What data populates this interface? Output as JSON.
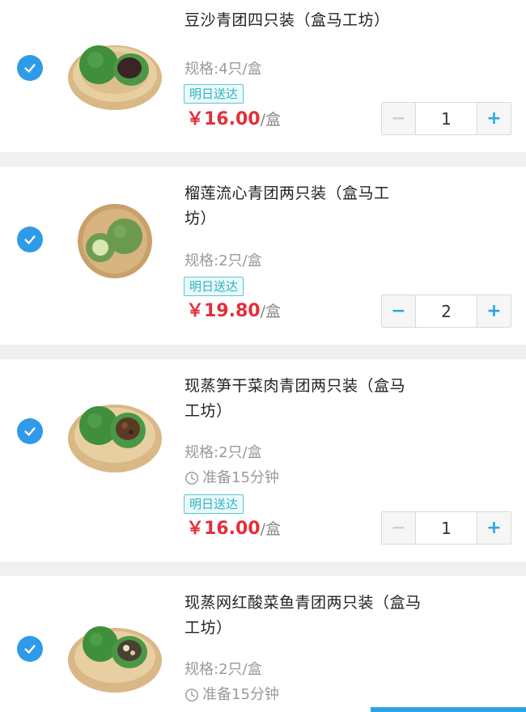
{
  "colors": {
    "accent": "#2f9be8",
    "price": "#e2303b",
    "badge": "#2fb3bf"
  },
  "items": [
    {
      "title": "豆沙青团四只装（盒马工坊）",
      "spec": "规格:4只/盒",
      "badge": "明日送达",
      "price": "￥16.00",
      "unit": "/盒",
      "minus": "−",
      "quantity": "1",
      "plus": "+",
      "checked": true,
      "image": "red-bean-qingtuan"
    },
    {
      "title": "榴莲流心青团两只装（盒马工坊）",
      "spec": "规格:2只/盒",
      "badge": "明日送达",
      "price": "￥19.80",
      "unit": "/盒",
      "minus": "−",
      "quantity": "2",
      "plus": "+",
      "checked": true,
      "image": "durian-qingtuan"
    },
    {
      "title": "现蒸笋干菜肉青团两只装（盒马工坊）",
      "spec": "规格:2只/盒",
      "prep": "准备15分钟",
      "badge": "明日送达",
      "price": "￥16.00",
      "unit": "/盒",
      "minus": "−",
      "quantity": "1",
      "plus": "+",
      "checked": true,
      "image": "pork-qingtuan"
    },
    {
      "title": "现蒸网红酸菜鱼青团两只装（盒马工坊）",
      "spec": "规格:2只/盒",
      "prep": "准备15分钟",
      "checked": true,
      "image": "fish-qingtuan"
    }
  ]
}
